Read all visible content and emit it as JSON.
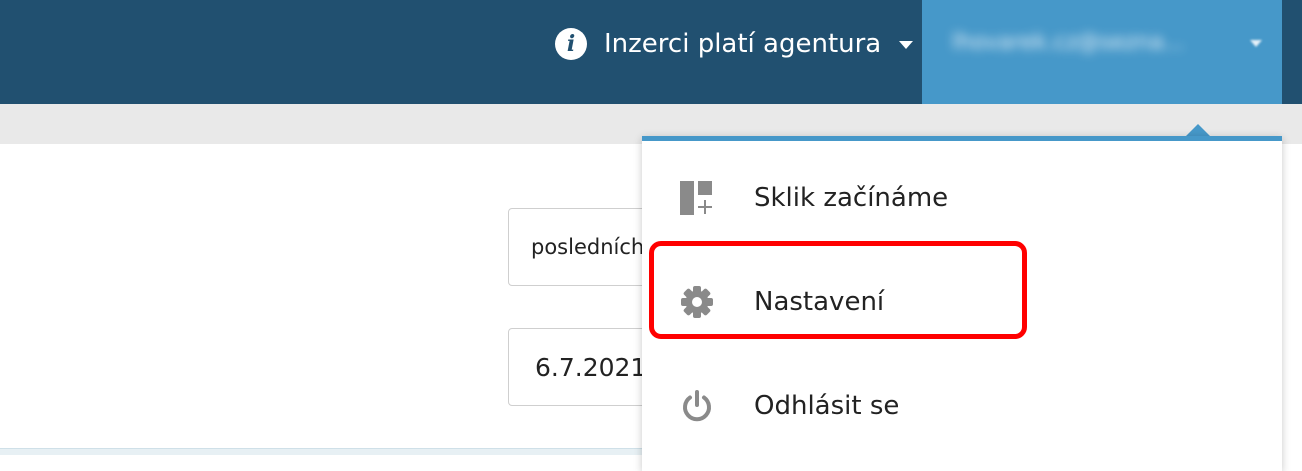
{
  "header": {
    "agency_label": "Inzerci platí agentura",
    "account_email": "lhovarek.cz@sezna..."
  },
  "filters": {
    "period_value": "posledních",
    "date_value": "6.7.2021"
  },
  "account_menu": {
    "items": [
      {
        "label": "Sklik začínáme",
        "icon": "dashboard-add-icon"
      },
      {
        "label": "Nastavení",
        "icon": "gear-icon"
      },
      {
        "label": "Odhlásit se",
        "icon": "power-icon"
      }
    ]
  },
  "colors": {
    "header_bg": "#215070",
    "account_bg": "#4698c9",
    "highlight": "#ff0000",
    "icon_gray": "#8a8a8a"
  }
}
